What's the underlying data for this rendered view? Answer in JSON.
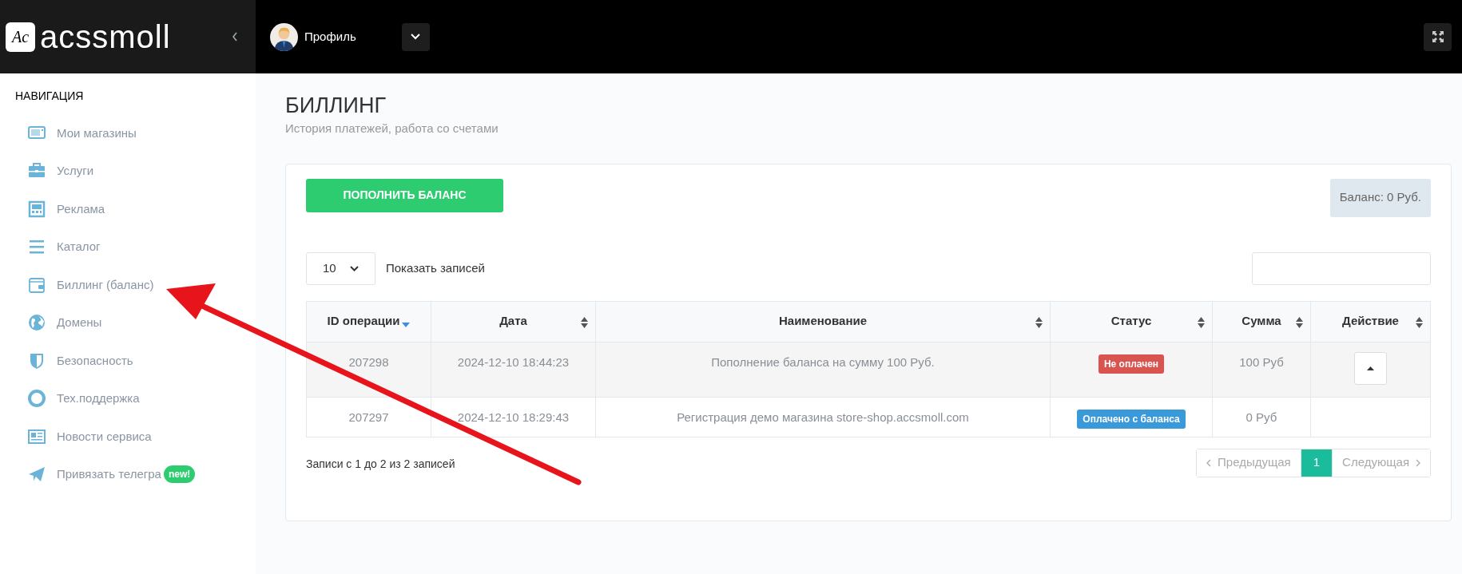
{
  "logo": {
    "badge": "Ac",
    "text": "acssmoll"
  },
  "header": {
    "profile": "Профиль"
  },
  "sidebar": {
    "heading": "НАВИГАЦИЯ",
    "items": [
      {
        "label": "Мои магазины"
      },
      {
        "label": "Услуги"
      },
      {
        "label": "Реклама"
      },
      {
        "label": "Каталог"
      },
      {
        "label": "Биллинг (баланс)"
      },
      {
        "label": "Домены"
      },
      {
        "label": "Безопасность"
      },
      {
        "label": "Тех.поддержка"
      },
      {
        "label": "Новости сервиса"
      },
      {
        "label": "Привязать телегра",
        "badge": "new!"
      }
    ]
  },
  "page": {
    "title": "БИЛЛИНГ",
    "subtitle": "История платежей, работа со счетами"
  },
  "top_up_button": "ПОПОЛНИТЬ БАЛАНС",
  "balance": "Баланс: 0 Руб.",
  "page_size": {
    "value": "10",
    "label": "Показать записей"
  },
  "table": {
    "columns": [
      {
        "label": "ID операции",
        "sorted": true
      },
      {
        "label": "Дата",
        "sorted": false
      },
      {
        "label": "Наименование",
        "sorted": false
      },
      {
        "label": "Статус",
        "sorted": false
      },
      {
        "label": "Сумма",
        "sorted": false
      },
      {
        "label": "Действие",
        "sorted": false
      }
    ],
    "rows": [
      {
        "id": "207298",
        "date": "2024-12-10 18:44:23",
        "name": "Пополнение баланса на сумму 100 Руб.",
        "status": "Не оплачен",
        "color": "#d9534f",
        "sum": "100 Руб",
        "action_button": true
      },
      {
        "id": "207297",
        "date": "2024-12-10 18:29:43",
        "name": "Регистрация демо магазина store-shop.accsmoll.com",
        "status": "Оплачено с баланса",
        "color": "#3a9ad9",
        "sum": "0 Руб",
        "action_button": false
      }
    ]
  },
  "footer_info": "Записи с 1 до 2 из 2 записей",
  "pagination": [
    {
      "kind": "prev",
      "label": "Предыдущая",
      "selected": false,
      "disabled": true
    },
    {
      "kind": "page",
      "label": "1",
      "selected": true
    },
    {
      "kind": "next",
      "label": "Следующая",
      "selected": false,
      "disabled": true
    }
  ]
}
